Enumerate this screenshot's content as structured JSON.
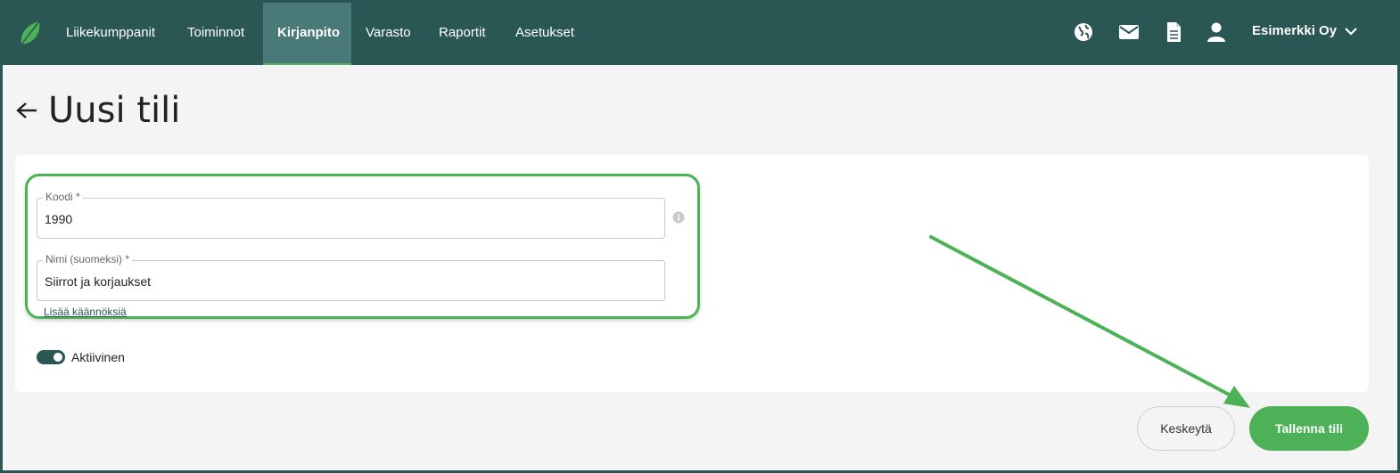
{
  "nav": {
    "items": [
      {
        "label": "Liikekumppanit",
        "active": false
      },
      {
        "label": "Toiminnot",
        "active": false
      },
      {
        "label": "Kirjanpito",
        "active": true
      },
      {
        "label": "Varasto",
        "active": false
      },
      {
        "label": "Raportit",
        "active": false
      },
      {
        "label": "Asetukset",
        "active": false
      }
    ],
    "icons": [
      "globe-icon",
      "mail-icon",
      "document-icon",
      "user-icon"
    ],
    "company": "Esimerkki Oy"
  },
  "page": {
    "title": "Uusi tili"
  },
  "form": {
    "code": {
      "label": "Koodi",
      "required_mark": "*",
      "value": "1990"
    },
    "name": {
      "label": "Nimi (suomeksi)",
      "required_mark": "*",
      "value": "Siirrot ja korjaukset"
    },
    "translations_link": "Lisää käännöksiä",
    "active": {
      "label": "Aktiivinen",
      "on": true
    }
  },
  "actions": {
    "cancel": "Keskeytä",
    "save": "Tallenna tili"
  },
  "colors": {
    "header": "#2a5654",
    "accent": "#4db257",
    "background": "#f3f4f3"
  }
}
